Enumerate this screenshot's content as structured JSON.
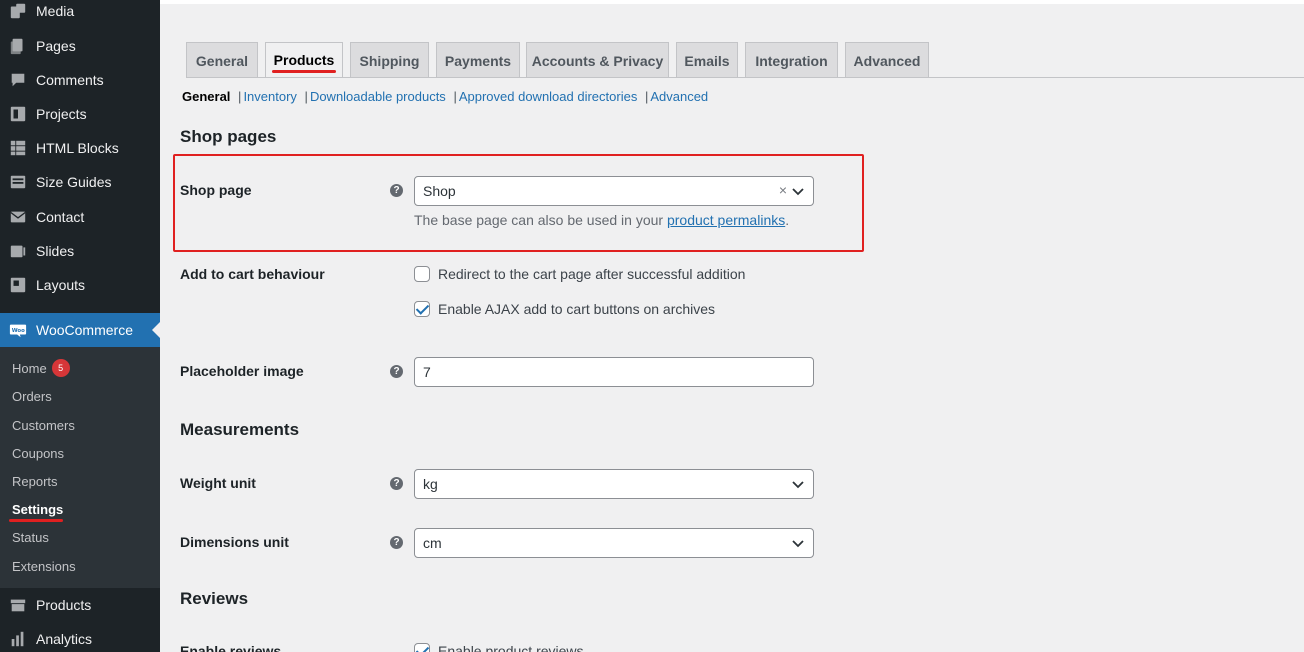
{
  "sidebar": {
    "items": [
      {
        "label": "Media",
        "icon": "media-icon"
      },
      {
        "label": "Pages",
        "icon": "pages-icon"
      },
      {
        "label": "Comments",
        "icon": "comments-icon"
      },
      {
        "label": "Projects",
        "icon": "projects-icon"
      },
      {
        "label": "HTML Blocks",
        "icon": "html-blocks-icon"
      },
      {
        "label": "Size Guides",
        "icon": "size-guides-icon"
      },
      {
        "label": "Contact",
        "icon": "envelope-icon"
      },
      {
        "label": "Slides",
        "icon": "slides-icon"
      },
      {
        "label": "Layouts",
        "icon": "layouts-icon"
      },
      {
        "label": "WooCommerce",
        "icon": "woocommerce-icon"
      },
      {
        "label": "Products",
        "icon": "products-icon"
      },
      {
        "label": "Analytics",
        "icon": "analytics-icon"
      }
    ],
    "woo_icon_text": "Woo",
    "submenu": [
      {
        "label": "Home",
        "badge": "5"
      },
      {
        "label": "Orders"
      },
      {
        "label": "Customers"
      },
      {
        "label": "Coupons"
      },
      {
        "label": "Reports"
      },
      {
        "label": "Settings"
      },
      {
        "label": "Status"
      },
      {
        "label": "Extensions"
      }
    ],
    "accent_color": "#2271b1"
  },
  "tabs": [
    "General",
    "Products",
    "Shipping",
    "Payments",
    "Accounts & Privacy",
    "Emails",
    "Integration",
    "Advanced"
  ],
  "subsections": {
    "current": "General",
    "links": [
      "Inventory",
      "Downloadable products",
      "Approved download directories",
      "Advanced"
    ],
    "separator": "|"
  },
  "main": {
    "shop_pages_title": "Shop pages",
    "shop_page": {
      "label": "Shop page",
      "help": "?",
      "value": "Shop",
      "clear": "×",
      "desc_prefix": "The base page can also be used in your ",
      "desc_link": "product permalinks",
      "desc_suffix": "."
    },
    "add_to_cart": {
      "label": "Add to cart behaviour",
      "options": [
        {
          "label": "Redirect to the cart page after successful addition",
          "checked": false
        },
        {
          "label": "Enable AJAX add to cart buttons on archives",
          "checked": true
        }
      ]
    },
    "placeholder_image": {
      "label": "Placeholder image",
      "value": "7"
    },
    "measurements_title": "Measurements",
    "weight_unit": {
      "label": "Weight unit",
      "value": "kg"
    },
    "dimensions_unit": {
      "label": "Dimensions unit",
      "value": "cm"
    },
    "reviews_title": "Reviews",
    "enable_reviews": {
      "label": "Enable reviews",
      "option": "Enable product reviews"
    }
  },
  "annotation_color": "#e02020"
}
